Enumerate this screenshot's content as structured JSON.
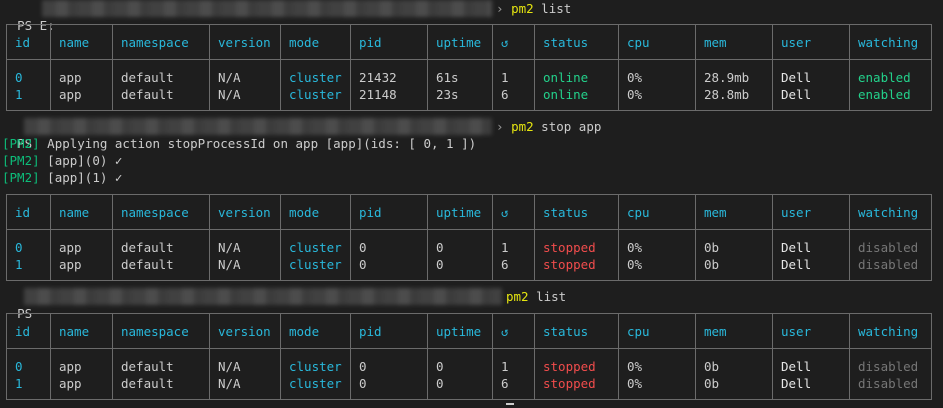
{
  "columns": [
    "id",
    "name",
    "namespace",
    "version",
    "mode",
    "pid",
    "uptime",
    "↺",
    "status",
    "cpu",
    "mem",
    "user",
    "watching"
  ],
  "prompt1": {
    "ps": "PS E:",
    "arrow": "›",
    "prog": "pm2",
    "args": "list"
  },
  "table1": [
    {
      "id": "0",
      "name": "app",
      "namespace": "default",
      "version": "N/A",
      "mode": "cluster",
      "pid": "21432",
      "uptime": "61s",
      "restarts": "1",
      "status": "online",
      "cpu": "0%",
      "mem": "28.9mb",
      "user": "Dell",
      "watching": "enabled"
    },
    {
      "id": "1",
      "name": "app",
      "namespace": "default",
      "version": "N/A",
      "mode": "cluster",
      "pid": "21148",
      "uptime": "23s",
      "restarts": "6",
      "status": "online",
      "cpu": "0%",
      "mem": "28.8mb",
      "user": "Dell",
      "watching": "enabled"
    }
  ],
  "prompt2": {
    "ps": "PS",
    "arrow": "›",
    "prog": "pm2",
    "args": "stop app"
  },
  "log": [
    {
      "tag": "[PM2]",
      "text": " Applying action stopProcessId on app [app](ids: [ 0, 1 ])"
    },
    {
      "tag": "[PM2]",
      "text": " [app](0) ✓"
    },
    {
      "tag": "[PM2]",
      "text": " [app](1) ✓"
    }
  ],
  "table2": [
    {
      "id": "0",
      "name": "app",
      "namespace": "default",
      "version": "N/A",
      "mode": "cluster",
      "pid": "0",
      "uptime": "0",
      "restarts": "1",
      "status": "stopped",
      "cpu": "0%",
      "mem": "0b",
      "user": "Dell",
      "watching": "disabled"
    },
    {
      "id": "1",
      "name": "app",
      "namespace": "default",
      "version": "N/A",
      "mode": "cluster",
      "pid": "0",
      "uptime": "0",
      "restarts": "6",
      "status": "stopped",
      "cpu": "0%",
      "mem": "0b",
      "user": "Dell",
      "watching": "disabled"
    }
  ],
  "prompt3": {
    "ps": "PS",
    "arrow": "",
    "prog": "pm2",
    "args": "list"
  },
  "table3": [
    {
      "id": "0",
      "name": "app",
      "namespace": "default",
      "version": "N/A",
      "mode": "cluster",
      "pid": "0",
      "uptime": "0",
      "restarts": "1",
      "status": "stopped",
      "cpu": "0%",
      "mem": "0b",
      "user": "Dell",
      "watching": "disabled"
    },
    {
      "id": "1",
      "name": "app",
      "namespace": "default",
      "version": "N/A",
      "mode": "cluster",
      "pid": "0",
      "uptime": "0",
      "restarts": "6",
      "status": "stopped",
      "cpu": "0%",
      "mem": "0b",
      "user": "Dell",
      "watching": "disabled"
    }
  ],
  "colors": {
    "background": "#1e1e1e",
    "header": "#29b8db",
    "online": "#23d18b",
    "stopped": "#f14c4c",
    "prompt_cmd": "#e5e510",
    "pm2_tag": "#0dbc79"
  }
}
